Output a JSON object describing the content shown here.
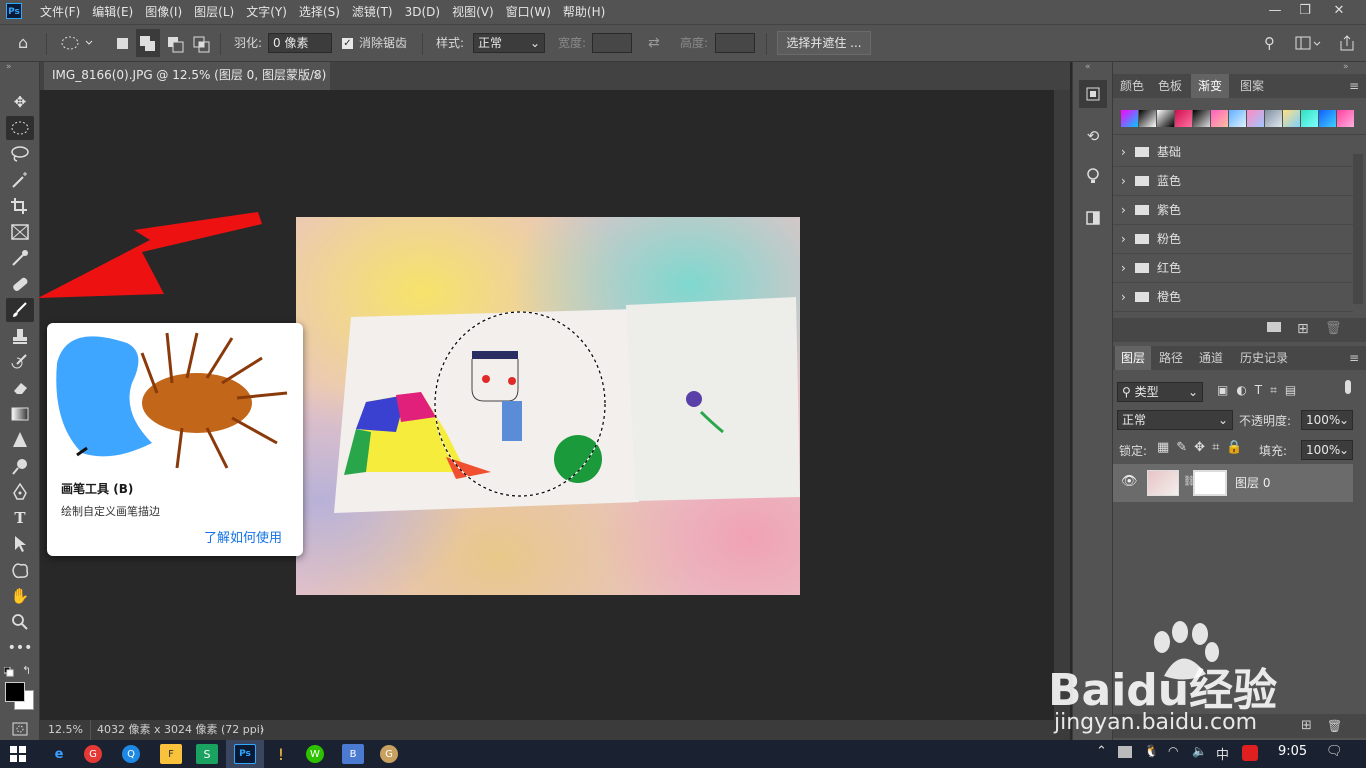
{
  "app": {
    "logo_text": "Ps"
  },
  "menu": [
    "文件(F)",
    "编辑(E)",
    "图像(I)",
    "图层(L)",
    "文字(Y)",
    "选择(S)",
    "滤镜(T)",
    "3D(D)",
    "视图(V)",
    "窗口(W)",
    "帮助(H)"
  ],
  "window_controls": {
    "minimize": "—",
    "restore": "❐",
    "close": "✕"
  },
  "options_bar": {
    "feather_label": "羽化:",
    "feather_value": "0 像素",
    "antialias_label": "消除锯齿",
    "antialias_checked": true,
    "style_label": "样式:",
    "style_value": "正常",
    "width_label": "宽度:",
    "height_label": "高度:",
    "select_mask_button": "选择并遮住 ..."
  },
  "document": {
    "tab_title": "IMG_8166(0).JPG @ 12.5% (图层 0, 图层蒙版/8) *",
    "tab_close": "×",
    "zoom": "12.5%",
    "dimensions": "4032 像素 x 3024 像素 (72 ppi)",
    "status_arrow": "›"
  },
  "tooltip": {
    "title": "画笔工具",
    "shortcut": "(B)",
    "description": "绘制自定义画笔描边",
    "link": "了解如何使用"
  },
  "right_panel": {
    "top_tabs": [
      "颜色",
      "色板",
      "渐变",
      "图案"
    ],
    "top_active_tab": "渐变",
    "gradient_swatches": [
      "#4060ff",
      "#101010",
      "#ffffff",
      "#ff3060",
      "#ff70c0",
      "#80c0ff",
      "#a0b0c0",
      "#ffe070",
      "#50e0ff",
      "#2040a0"
    ],
    "gradient_folders": [
      "基础",
      "蓝色",
      "紫色",
      "粉色",
      "红色",
      "橙色"
    ],
    "layers_tabs": [
      "图层",
      "路径",
      "通道",
      "历史记录"
    ],
    "layers_active_tab": "图层",
    "filter_kind": "类型",
    "blend_mode": "正常",
    "opacity_label": "不透明度:",
    "opacity_value": "100%",
    "lock_label": "锁定:",
    "fill_label": "填充:",
    "fill_value": "100%",
    "layer_name": "图层 0"
  },
  "watermark": {
    "brand": "Baidu经验",
    "url": "jingyan.baidu.com"
  },
  "taskbar": {
    "time": "9:05",
    "ime": "中",
    "app_labels": [
      "e",
      "G",
      "Q",
      "F",
      "S",
      "Ps",
      "!",
      "W",
      "B",
      "G"
    ]
  }
}
